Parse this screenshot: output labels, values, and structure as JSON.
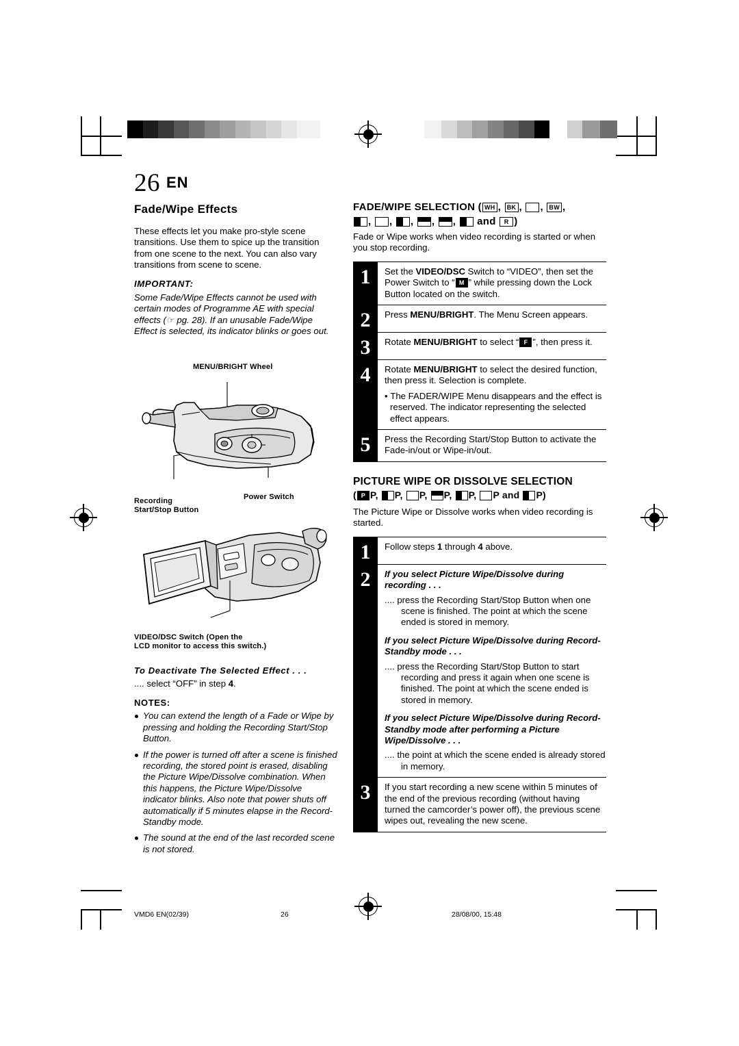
{
  "page": {
    "number": "26",
    "lang": "EN"
  },
  "left": {
    "section_title": "Fade/Wipe Effects",
    "intro": "These effects let you make pro-style scene transitions. Use them to spice up the transition from one scene to the next. You can also vary transitions from scene to scene.",
    "important_label": "IMPORTANT:",
    "important_text": "Some Fade/Wipe Effects cannot be used with certain modes of Programme AE with special effects (☞ pg. 28). If an unusable Fade/Wipe Effect is selected, its indicator blinks or goes out.",
    "callouts": {
      "menu_wheel": "MENU/BRIGHT Wheel",
      "recording_button": "Recording\nStart/Stop Button",
      "power_switch": "Power Switch",
      "video_dsc": "VIDEO/DSC Switch (Open the\nLCD monitor to access this switch.)"
    },
    "deactivate_label": "To Deactivate The Selected Effect . . .",
    "deactivate_text": ".... select “OFF” in step 4.",
    "deactivate_step": "4",
    "notes_label": "NOTES:",
    "notes": [
      "You can extend the length of a Fade or Wipe by pressing and holding the Recording Start/Stop Button.",
      "If the power is turned off after a scene is finished recording, the stored point is erased, disabling the Picture Wipe/Dissolve combination. When this happens, the Picture Wipe/Dissolve indicator blinks. Also note that power shuts off automatically if 5 minutes elapse in the Record-Standby mode.",
      "The sound at the end of the last recorded scene is not stored."
    ]
  },
  "right": {
    "fade_heading_prefix": "FADE/WIPE SELECTION (",
    "fade_heading_suffix": "and",
    "fade_heading_close": ")",
    "fade_icons_line1": [
      "WH",
      "BK",
      "X",
      "BW"
    ],
    "fade_icons_line2": [
      "b1",
      "b2",
      "b3",
      "b4",
      "b5",
      "b6",
      "R"
    ],
    "fade_intro": "Fade or Wipe works when video recording is started or when you stop recording.",
    "fade_steps": [
      {
        "num": "1",
        "text_parts": [
          "Set the ",
          "VIDEO/DSC",
          " Switch to “VIDEO”, then set the Power Switch to “",
          "M",
          "” while pressing down the Lock Button located on the switch."
        ]
      },
      {
        "num": "2",
        "text_parts": [
          "Press ",
          "MENU/BRIGHT",
          ". The Menu Screen appears."
        ]
      },
      {
        "num": "3",
        "text_parts": [
          "Rotate ",
          "MENU/BRIGHT",
          " to select “",
          "FD",
          "”, then press it."
        ]
      },
      {
        "num": "4",
        "text_parts": [
          "Rotate ",
          "MENU/BRIGHT",
          " to select the desired function, then press it. Selection is complete."
        ],
        "bullet": "The FADER/WIPE Menu disappears and the effect is reserved. The indicator representing the selected effect appears."
      },
      {
        "num": "5",
        "text_parts": [
          "Press the Recording Start/Stop Button to activate the Fade-in/out or Wipe-in/out."
        ]
      }
    ],
    "picture_heading": "PICTURE WIPE OR DISSOLVE SELECTION",
    "picture_subheading_open": "(",
    "picture_subheading_close": ")",
    "picture_icons": [
      "P",
      "P",
      "P",
      "P",
      "P",
      "P"
    ],
    "picture_last": "and",
    "picture_intro": "The Picture Wipe or Dissolve works when video recording is started.",
    "picture_steps": [
      {
        "num": "1",
        "text_parts": [
          "Follow steps ",
          "1",
          " through ",
          "4",
          " above."
        ]
      },
      {
        "num": "2",
        "heading": "If you select Picture Wipe/Dissolve during recording . . .",
        "body": ".... press the Recording Start/Stop Button when one scene is finished. The point at which the scene ended is stored in memory.",
        "heading2": "If you select Picture Wipe/Dissolve during Record-Standby mode . . .",
        "body2": ".... press the Recording Start/Stop Button to start recording and press it again when one scene is finished. The point at which the scene ended is stored in memory.",
        "heading3": "If you select Picture Wipe/Dissolve during Record-Standby mode after performing a Picture Wipe/Dissolve . . .",
        "body3": ".... the point at which the scene ended is already stored in memory."
      },
      {
        "num": "3",
        "text_parts": [
          "If you start recording a new scene within 5 minutes of the end of the previous recording (without having turned the camcorder’s power off), the previous scene wipes out, revealing the new scene."
        ]
      }
    ]
  },
  "footer": {
    "file": "VMD6 EN(02/39)",
    "page": "26",
    "date": "28/08/00, 15:48"
  }
}
